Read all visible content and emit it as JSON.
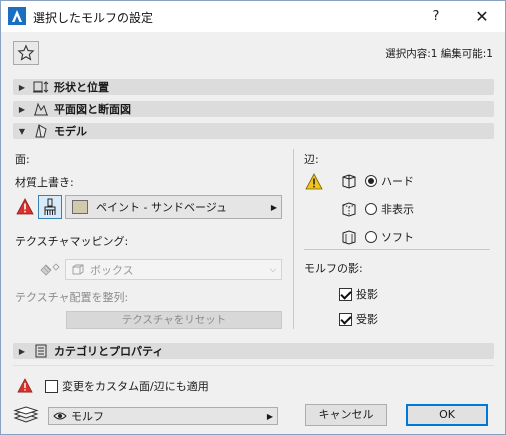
{
  "window": {
    "title": "選択したモルフの設定",
    "help_label": "?",
    "close_label": "✕"
  },
  "header": {
    "favorites_icon": "star-icon",
    "selection_info": "選択内容:1 編集可能:1"
  },
  "sections": {
    "shape": {
      "label": "形状と位置",
      "icon": "shape-position-icon",
      "expanded": false
    },
    "plan": {
      "label": "平面図と断面図",
      "icon": "plan-section-icon",
      "expanded": false
    },
    "model": {
      "label": "モデル",
      "icon": "model-icon",
      "expanded": true
    },
    "category": {
      "label": "カテゴリとプロパティ",
      "icon": "category-properties-icon",
      "expanded": false
    }
  },
  "model": {
    "face_label": "面:",
    "material_override_label": "材質上書き:",
    "material_value": "ペイント - サンドベージュ",
    "material_swatch_color": "#d1c8ad",
    "texture_mapping_label": "テクスチャマッピング:",
    "texture_mapping_value": "ボックス",
    "texture_align_label": "テクスチャ配置を整列:",
    "texture_reset_label": "テクスチャをリセット",
    "edge_label": "辺:",
    "edge_options": [
      {
        "label": "ハード",
        "selected": true
      },
      {
        "label": "非表示",
        "selected": false
      },
      {
        "label": "ソフト",
        "selected": false
      }
    ],
    "shadow_label": "モルフの影:",
    "cast_shadow_label": "投影",
    "cast_shadow_checked": true,
    "receive_shadow_label": "受影",
    "receive_shadow_checked": true
  },
  "footer": {
    "apply_custom_label": "変更をカスタム面/辺にも適用",
    "apply_custom_checked": false,
    "layer_value": "モルフ",
    "cancel_label": "キャンセル",
    "ok_label": "OK"
  },
  "colors": {
    "warning": "#f0c419",
    "error": "#d9302c",
    "accent": "#0078d7"
  }
}
